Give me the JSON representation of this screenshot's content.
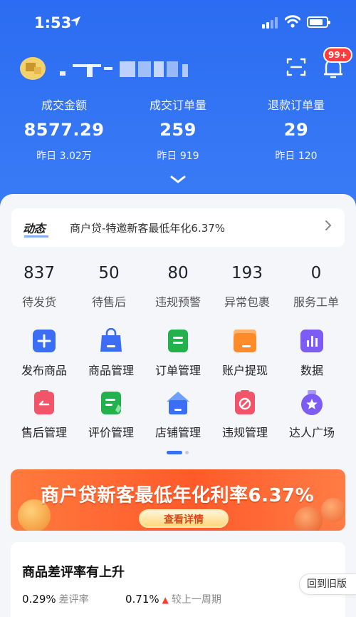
{
  "status_bar": {
    "time": "1:53"
  },
  "header": {
    "notification_badge": "99+"
  },
  "stats": [
    {
      "label": "成交金额",
      "value": "8577.29",
      "yesterday": "昨日 3.02万"
    },
    {
      "label": "成交订单量",
      "value": "259",
      "yesterday": "昨日 919"
    },
    {
      "label": "退款订单量",
      "value": "29",
      "yesterday": "昨日 120"
    }
  ],
  "news": {
    "tag": "动态",
    "text": "商户贷-特邀新客最低年化6.37%"
  },
  "counts": [
    {
      "value": "837",
      "label": "待发货"
    },
    {
      "value": "50",
      "label": "待售后"
    },
    {
      "value": "80",
      "label": "违规预警"
    },
    {
      "value": "193",
      "label": "异常包裹"
    },
    {
      "value": "0",
      "label": "服务工单"
    }
  ],
  "tools": [
    {
      "label": "发布商品",
      "icon": "plus-icon",
      "color": "#3b6ef5"
    },
    {
      "label": "商品管理",
      "icon": "shopping-bag-icon",
      "color": "#3b6ef5"
    },
    {
      "label": "订单管理",
      "icon": "document-icon",
      "color": "#22b14c"
    },
    {
      "label": "账户提现",
      "icon": "folder-wallet-icon",
      "color": "#ff8a2a"
    },
    {
      "label": "数据",
      "icon": "bar-chart-icon",
      "color": "#7c5cf5"
    },
    {
      "label": "售后管理",
      "icon": "return-icon",
      "color": "#f2556a"
    },
    {
      "label": "评价管理",
      "icon": "review-icon",
      "color": "#22b14c"
    },
    {
      "label": "店铺管理",
      "icon": "store-icon",
      "color": "#3b6ef5"
    },
    {
      "label": "违规管理",
      "icon": "prohibited-icon",
      "color": "#f2556a"
    },
    {
      "label": "达人广场",
      "icon": "star-badge-icon",
      "color": "#7c5cf5"
    }
  ],
  "carousel": {
    "active_page": 1,
    "total_pages": 2
  },
  "banner": {
    "headline": "商户贷新客最低年化利率6.37%",
    "cta": "查看详情"
  },
  "review_card": {
    "title": "商品差评率有上升",
    "metrics": [
      {
        "value": "0.29%",
        "label": "差评率"
      },
      {
        "value": "0.71%",
        "label": "较上一周期"
      }
    ]
  },
  "back_to_old": "回到旧版",
  "colors": {
    "hero": "#2b6cf2",
    "accent": "#3b6ef5",
    "banner": "#ff5a2a",
    "alert": "#ff3b3b"
  }
}
